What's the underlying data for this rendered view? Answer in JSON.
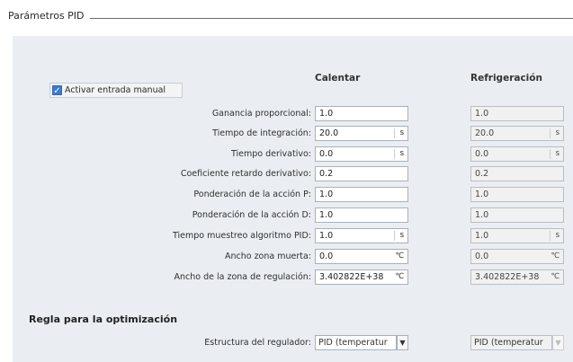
{
  "section": {
    "title": "Parámetros PID"
  },
  "columns": {
    "heat": "Calentar",
    "cool": "Refrigeración"
  },
  "manual_entry": {
    "label": "Activar entrada manual",
    "checked": true
  },
  "rows": [
    {
      "label": "Ganancia proporcional:",
      "heat": "1.0",
      "cool": "1.0",
      "unit": ""
    },
    {
      "label": "Tiempo de integración:",
      "heat": "20.0",
      "cool": "20.0",
      "unit": "s"
    },
    {
      "label": "Tiempo derivativo:",
      "heat": "0.0",
      "cool": "0.0",
      "unit": "s"
    },
    {
      "label": "Coeficiente retardo derivativo:",
      "heat": "0.2",
      "cool": "0.2",
      "unit": ""
    },
    {
      "label": "Ponderación de la acción P:",
      "heat": "1.0",
      "cool": "1.0",
      "unit": ""
    },
    {
      "label": "Ponderación de la acción D:",
      "heat": "1.0",
      "cool": "1.0",
      "unit": ""
    },
    {
      "label": "Tiempo muestreo algoritmo PID:",
      "heat": "1.0",
      "cool": "1.0",
      "unit": "s"
    },
    {
      "label": "Ancho zona muerta:",
      "heat": "0.0",
      "cool": "0.0",
      "unit": "℃"
    },
    {
      "label": "Ancho de la zona de regulación:",
      "heat": "3.402822E+38",
      "cool": "3.402822E+38",
      "unit": "℃"
    }
  ],
  "optimization": {
    "title": "Regla para la optimización",
    "structure_label": "Estructura del regulador:",
    "heat_value": "PID (temperatur",
    "cool_value": "PID (temperatur"
  }
}
